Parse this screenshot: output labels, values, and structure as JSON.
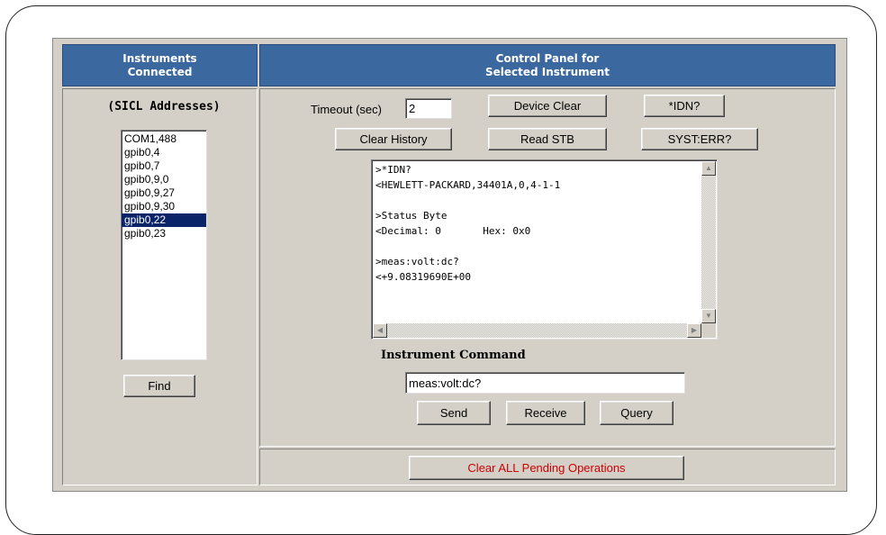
{
  "headers": {
    "left_line1": "Instruments",
    "left_line2": "Connected",
    "right_line1": "Control Panel for",
    "right_line2": "Selected Instrument"
  },
  "left": {
    "sicl_label": "(SICL Addresses)",
    "addresses": [
      "COM1,488",
      "gpib0,4",
      "gpib0,7",
      "gpib0,9,0",
      "gpib0,9,27",
      "gpib0,9,30",
      "gpib0,22",
      "gpib0,23"
    ],
    "selected_address": "gpib0,22",
    "find_label": "Find"
  },
  "controls": {
    "timeout_label": "Timeout (sec)",
    "timeout_value": "2",
    "device_clear_label": "Device Clear",
    "idn_label": "*IDN?",
    "clear_history_label": "Clear History",
    "read_stb_label": "Read STB",
    "syst_err_label": "SYST:ERR?"
  },
  "history": {
    "lines": [
      ">*IDN?",
      "<HEWLETT-PACKARD,34401A,0,4-1-1",
      "",
      ">Status Byte",
      "<Decimal: 0       Hex: 0x0",
      "",
      ">meas:volt:dc?",
      "<+9.08319690E+00"
    ]
  },
  "command": {
    "label": "Instrument Command",
    "value": "meas:volt:dc?",
    "send_label": "Send",
    "receive_label": "Receive",
    "query_label": "Query"
  },
  "footer": {
    "clear_all_label": "Clear ALL Pending Operations",
    "clear_all_color": "#cc0000"
  },
  "colors": {
    "header_bg": "#3c68a0",
    "panel_bg": "#d4d0c8",
    "selection_bg": "#0a246a"
  }
}
